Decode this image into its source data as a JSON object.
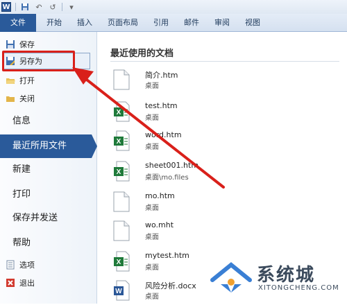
{
  "qat": {
    "logo": "W",
    "undo": "↶",
    "redo": "↺",
    "more": "▾"
  },
  "tabs": [
    "文件",
    "开始",
    "插入",
    "页面布局",
    "引用",
    "邮件",
    "审阅",
    "视图"
  ],
  "nav": {
    "small_top": [
      {
        "label": "保存",
        "icon": "save-icon"
      },
      {
        "label": "另存为",
        "icon": "save-as-icon"
      },
      {
        "label": "打开",
        "icon": "open-folder-icon"
      },
      {
        "label": "关闭",
        "icon": "close-folder-icon"
      }
    ],
    "big": [
      "信息",
      "最近所用文件",
      "新建",
      "打印",
      "保存并发送",
      "帮助"
    ],
    "small_bottom": [
      {
        "label": "选项",
        "icon": "options-icon"
      },
      {
        "label": "退出",
        "icon": "exit-icon"
      }
    ]
  },
  "main": {
    "title": "最近使用的文档",
    "files": [
      {
        "name": "简介.htm",
        "location": "桌面",
        "icon": "blank-document-icon"
      },
      {
        "name": "test.htm",
        "location": "桌面",
        "icon": "excel-document-icon"
      },
      {
        "name": "word.htm",
        "location": "桌面",
        "icon": "excel-document-icon"
      },
      {
        "name": "sheet001.htm",
        "location": "桌面\\mo.files",
        "icon": "excel-document-icon"
      },
      {
        "name": "mo.htm",
        "location": "桌面",
        "icon": "blank-document-icon"
      },
      {
        "name": "wo.mht",
        "location": "桌面",
        "icon": "blank-document-icon"
      },
      {
        "name": "mytest.htm",
        "location": "桌面",
        "icon": "excel-document-icon"
      },
      {
        "name": "风险分析.docx",
        "location": "桌面",
        "icon": "word-document-icon"
      }
    ]
  },
  "watermark": {
    "title": "系统城",
    "subtitle": "XITONGCHENG.COM"
  },
  "colors": {
    "accent": "#2a5a9a",
    "highlight_red": "#d9201a",
    "excel_green": "#1f7a3a"
  }
}
